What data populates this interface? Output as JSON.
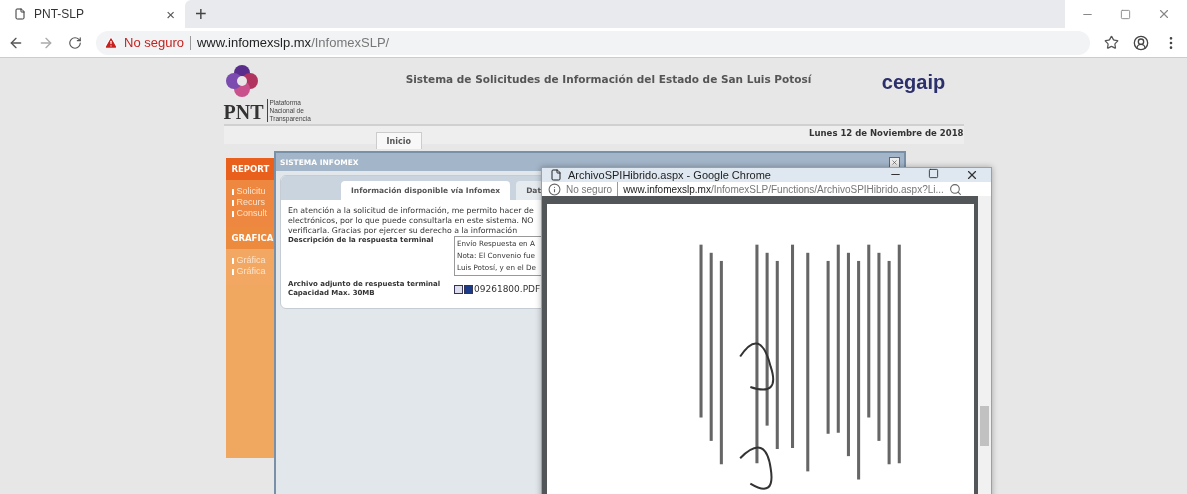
{
  "browser": {
    "tabs": [
      {
        "title": "PNT-SLP",
        "close": "×",
        "selected": true
      }
    ],
    "new_tab": "+",
    "security": "No seguro",
    "url_host": "www.infomexslp.mx",
    "url_path": "/InfomexSLP/"
  },
  "page": {
    "logo_left": {
      "mark": "PNT",
      "caption_lines": [
        "Plataforma",
        "Nacional de",
        "Transparencia"
      ]
    },
    "title": "Sistema de Solicitudes de Información del Estado de San Luis Potosí",
    "logo_right": {
      "mark": "cegaip"
    },
    "date": "Lunes 12 de Noviembre de 2018",
    "nav_tabs": [
      {
        "label": "Inicio"
      }
    ],
    "sidebar": [
      {
        "heading": "REPORT",
        "items": [
          "Solicitu",
          "Recurs",
          "Consult"
        ]
      },
      {
        "heading": "GRAFICA",
        "items": [
          "Gráfica",
          "Gráfica"
        ]
      }
    ]
  },
  "modal": {
    "title": "SISTEMA INFOMEX",
    "tabs": [
      {
        "label": "Información disponible vía Infomex",
        "selected": true
      },
      {
        "label": "Dat",
        "selected": false
      }
    ],
    "message_lines": [
      "En atención a la solicitud de información, me permito hacer de",
      "electrónicos, por lo que puede consultarla en este sistema. NO",
      "verificarla. Gracias por ejercer su derecho a la información"
    ],
    "fields": [
      {
        "kind": "textarea",
        "label_lines": [
          "Descripción de la respuesta terminal"
        ],
        "lines": [
          "Envío Respuesta en A",
          "Nota: El Convenio fue",
          "Luis Potosí, y en el De"
        ]
      },
      {
        "kind": "attachment",
        "label_lines": [
          "Archivo adjunto de respuesta terminal",
          "Capacidad Max. 30MB"
        ],
        "file": "09261800.PDF"
      }
    ]
  },
  "popup": {
    "title": "ArchivoSPIHibrido.aspx - Google Chrome",
    "security": "No seguro",
    "url_host": "www.infomexslp.mx",
    "url_path": "/InfomexSLP/Functions/ArchivoSPIHibrido.aspx?Li..."
  }
}
